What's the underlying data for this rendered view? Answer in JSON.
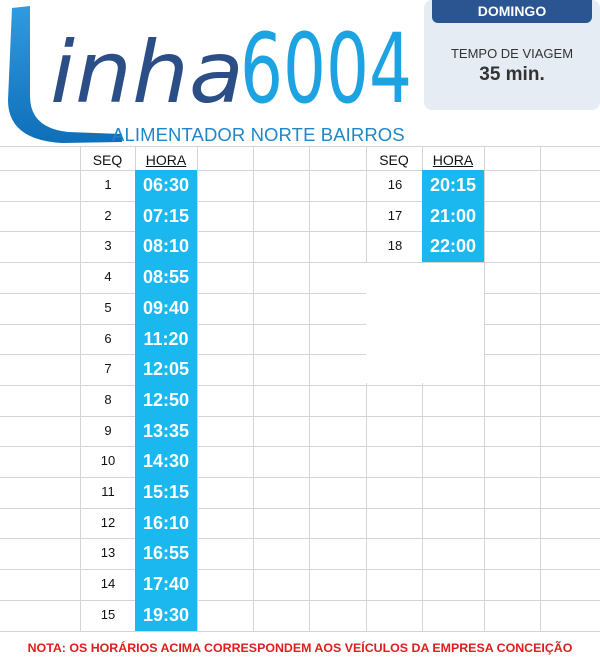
{
  "header": {
    "logo_word": "inha",
    "line_number": "6004",
    "subtitle": "ALIMENTADOR NORTE BAIRROS"
  },
  "info": {
    "day": "DOMINGO",
    "travel_time_label": "TEMPO DE VIAGEM",
    "travel_time_value": "35 min."
  },
  "table": {
    "seq_header": "SEQ",
    "time_header": "HORA",
    "left": [
      {
        "seq": "1",
        "time": "06:30"
      },
      {
        "seq": "2",
        "time": "07:15"
      },
      {
        "seq": "3",
        "time": "08:10"
      },
      {
        "seq": "4",
        "time": "08:55"
      },
      {
        "seq": "5",
        "time": "09:40"
      },
      {
        "seq": "6",
        "time": "11:20"
      },
      {
        "seq": "7",
        "time": "12:05"
      },
      {
        "seq": "8",
        "time": "12:50"
      },
      {
        "seq": "9",
        "time": "13:35"
      },
      {
        "seq": "10",
        "time": "14:30"
      },
      {
        "seq": "11",
        "time": "15:15"
      },
      {
        "seq": "12",
        "time": "16:10"
      },
      {
        "seq": "13",
        "time": "16:55"
      },
      {
        "seq": "14",
        "time": "17:40"
      },
      {
        "seq": "15",
        "time": "19:30"
      }
    ],
    "right": [
      {
        "seq": "16",
        "time": "20:15"
      },
      {
        "seq": "17",
        "time": "21:00"
      },
      {
        "seq": "18",
        "time": "22:00"
      }
    ]
  },
  "note": "NOTA: OS HORÁRIOS ACIMA CORRESPONDEM AOS VEÍCULOS DA  EMPRESA CONCEIÇÃO",
  "colors": {
    "brand_blue": "#1f87c9",
    "navy": "#2b5590",
    "cyan": "#1ab8ef",
    "note_red": "#e21b1b"
  }
}
